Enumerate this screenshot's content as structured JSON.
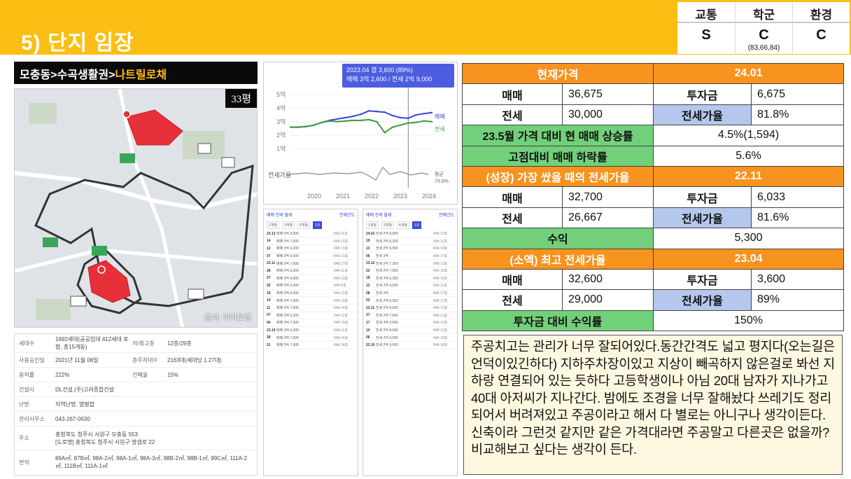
{
  "header": {
    "title": "5) 단지 임장",
    "grades": [
      {
        "label": "교통",
        "value": "S",
        "note": ""
      },
      {
        "label": "학군",
        "value": "C",
        "note": "(83,66,84)"
      },
      {
        "label": "환경",
        "value": "C",
        "note": ""
      }
    ]
  },
  "breadcrumb": {
    "part1": "모충동>수곡생활권>",
    "part2": "나트릴로채"
  },
  "map": {
    "pyeong": "33평",
    "credit": "출처: 카카오맵"
  },
  "info": {
    "households_label": "세대수",
    "households": "1692세대(공공임대 412세대 포함, 총15개동)",
    "floors_label": "저/최고층",
    "floors": "12층/29층",
    "approval_label": "사용승인일",
    "approval": "2021년 11월 08일",
    "parking_label": "총주차대수",
    "parking": "2163대(세대당 1.27대)",
    "far_label": "용적률",
    "far": "222%",
    "bcr_label": "건폐율",
    "bcr": "15%",
    "builder_label": "건설사",
    "builder": "DL건설,(주)고려종합건설",
    "heating_label": "난방",
    "heating": "지역난방, 열병합",
    "office_label": "관리사무소",
    "office": "043-267-0630",
    "address_label": "주소",
    "address1": "충청북도 청주시 서원구 모충동 553",
    "address2": "[도로명] 충청북도 청주시 서원구 쌍샘로 22",
    "area_label": "면적",
    "area": "86A㎡, 87B㎡, 98A-2㎡, 98A-1㎡, 98A-3㎡, 98B-2㎡, 98B-1㎡, 99C㎡, 111A-2㎡, 111B㎡, 111A-1㎡"
  },
  "price_chart": {
    "tooltip_line1": "2023.04  갭 3,600 (89%)",
    "tooltip_line2": "매매 3억 2,600 / 전세 2억 9,000",
    "y_ticks": [
      "5억",
      "4억",
      "3억",
      "2억",
      "1억"
    ],
    "jeonse_rate_label": "전세가율",
    "x_ticks": [
      "2020",
      "2021",
      "2022",
      "2023",
      "2024"
    ],
    "legend_sale": "매매",
    "legend_jeonse": "전세",
    "avg_label": "평균",
    "avg_value": "79.6%"
  },
  "chart_data": {
    "type": "line",
    "x": [
      "2019.07",
      "2019.10",
      "2020.01",
      "2020.04",
      "2020.07",
      "2020.10",
      "2021.01",
      "2021.04",
      "2021.07",
      "2021.10",
      "2022.01",
      "2022.04",
      "2022.07",
      "2022.10",
      "2023.01",
      "2023.04",
      "2023.07",
      "2023.10",
      "2024.01"
    ],
    "series": [
      {
        "name": "매매",
        "values": [
          2.6,
          2.6,
          2.65,
          2.75,
          2.95,
          3.1,
          3.2,
          3.3,
          3.4,
          3.55,
          3.8,
          3.75,
          3.7,
          3.45,
          3.3,
          3.26,
          3.5,
          3.6,
          3.67
        ]
      },
      {
        "name": "전세",
        "values": [
          2.6,
          2.6,
          2.65,
          2.75,
          2.95,
          3.05,
          3.0,
          3.05,
          3.1,
          3.1,
          3.15,
          3.0,
          2.2,
          2.6,
          2.75,
          2.9,
          2.95,
          3.05,
          3.0
        ]
      }
    ],
    "ylabel": "",
    "ylim": [
      0,
      5
    ]
  },
  "list_left": {
    "title": "매매 전세 월세",
    "sort": "전체년도",
    "tabs": [
      "1개월",
      "3개월",
      "6개월",
      "1년"
    ],
    "rows": [
      {
        "d": "23.12",
        "p": "매매 3억 6,500",
        "a": "84A 11층"
      },
      {
        "d": "14",
        "p": "매매 3억 7,000",
        "a": "84A 13층"
      },
      {
        "d": "12",
        "p": "매매 3억 6,200",
        "a": "84B 15층"
      },
      {
        "d": "07",
        "p": "매매 3억 6,000",
        "a": "84A 21층"
      },
      {
        "d": "23.11",
        "p": "매매 3억 7,600",
        "a": "84B 27층"
      },
      {
        "d": "28",
        "p": "매매 3억 6,000",
        "a": "84A 11층"
      },
      {
        "d": "27",
        "p": "매매 3억 6,800",
        "a": "84A 13층"
      },
      {
        "d": "25",
        "p": "매매 3억 5,900",
        "a": "84B 8층"
      },
      {
        "d": "19",
        "p": "매매 3억 6,500",
        "a": "84A 12층"
      },
      {
        "d": "14",
        "p": "매매 3억 7,000",
        "a": "84A 19층"
      },
      {
        "d": "11",
        "p": "매매 3억 7,000",
        "a": "84A 24층"
      },
      {
        "d": "07",
        "p": "매매 3억 6,300",
        "a": "84A 11층"
      },
      {
        "d": "04",
        "p": "매매 3억 7,500",
        "a": "84B 26층"
      },
      {
        "d": "23.10",
        "p": "매매 3억 6,300",
        "a": "84A 11층"
      },
      {
        "d": "28",
        "p": "매매 3억 7,500",
        "a": "84A 14층"
      },
      {
        "d": "21",
        "p": "매매 3억 7,900",
        "a": "84A 24층"
      }
    ]
  },
  "list_right": {
    "title": "매매 전세 월세",
    "sort": "전체년도",
    "tabs": [
      "1개월",
      "3개월",
      "6개월",
      "1년"
    ],
    "rows": [
      {
        "d": "24.01",
        "p": "전세 2억 9,000",
        "a": "84A 12층"
      },
      {
        "d": "19",
        "p": "전세 2억 6,350",
        "a": "84A 11층"
      },
      {
        "d": "13",
        "p": "전세 2억 9,500",
        "a": "84A 14층"
      },
      {
        "d": "06",
        "p": "전세 3억",
        "a": "84A 17층"
      },
      {
        "d": "23.12",
        "p": "전세 2억 7,300",
        "a": "84B 11층"
      },
      {
        "d": "22",
        "p": "전세 2억 7,000",
        "a": "84A 15층"
      },
      {
        "d": "18",
        "p": "전세 2억 6,250",
        "a": "84A 15층"
      },
      {
        "d": "13",
        "p": "전세 2억 9,000",
        "a": "84A 11층"
      },
      {
        "d": "08",
        "p": "전세 3억",
        "a": "84A 17층"
      },
      {
        "d": "02",
        "p": "전세 2억 6,250",
        "a": "84B 27층"
      },
      {
        "d": "23.11",
        "p": "전세 2억 8,000",
        "a": "84A 13층"
      },
      {
        "d": "27",
        "p": "전세 2억 7,000",
        "a": "84B 11층"
      },
      {
        "d": "17",
        "p": "전세 3억 2,000",
        "a": "84A 12층"
      },
      {
        "d": "10",
        "p": "전세 2억 8,000",
        "a": "84B 11층"
      },
      {
        "d": "06",
        "p": "전세 2억 9,000",
        "a": "84A 14층"
      },
      {
        "d": "23.10",
        "p": "전세 2억 9,500",
        "a": "84A 14층"
      }
    ]
  },
  "table": {
    "current_label": "현재가격",
    "current_date": "24.01",
    "sale_label": "매매",
    "sale": "36,675",
    "invest_label": "투자금",
    "invest": "6,675",
    "jeonse_label": "전세",
    "jeonse": "30,000",
    "rate_label": "전세가율",
    "rate": "81.8%",
    "rise_label": "23.5월 가격 대비 현 매매 상승률",
    "rise": "4.5%(1,594)",
    "drop_label": "고점대비 매매 하락률",
    "drop": "5.6%",
    "growth_label": "(성장) 가장 쌌을 때의 전세가율",
    "growth_date": "22.11",
    "g_sale": "32,700",
    "g_invest": "6,033",
    "g_jeonse": "26,667",
    "g_rate": "81.6%",
    "profit_label": "수익",
    "profit": "5,300",
    "consume_label": "(소액) 최고 전세가율",
    "consume_date": "23.04",
    "c_sale": "32,600",
    "c_invest": "3,600",
    "c_jeonse": "29,000",
    "c_rate": "89%",
    "roi_label": "투자금 대비 수익률",
    "roi": "150%"
  },
  "memo": "주공치고는 관리가 너무 잘되어있다.동간간격도 넓고 평지다(오는길은 언덕이있긴하다) 지하주차장이있고 지상이 빼곡하지 않은걸로 봐선 지하랑 연결되어 있는 듯하다 고등학생이나 아님 20대 남자가 지나가고 40대 아저씨가 지나간다. 밤에도 조경을 너무 잘해놨다 쓰레기도 정리되어서 버려져있고 주공이라고 해서 다 별로는 아니구나 생각이든다. 신축이라 그런것 같지만 같은 가격대라면 주공말고 다른곳은 없을까? 비교해보고 싶다는 생각이 든다.",
  "colors": {
    "accent": "#fdbe13",
    "orange": "#f7931e",
    "green": "#72d07a",
    "blue": "#b5c7ec",
    "sale_line": "#3b44d6",
    "jeonse_line": "#3f9a3f"
  }
}
